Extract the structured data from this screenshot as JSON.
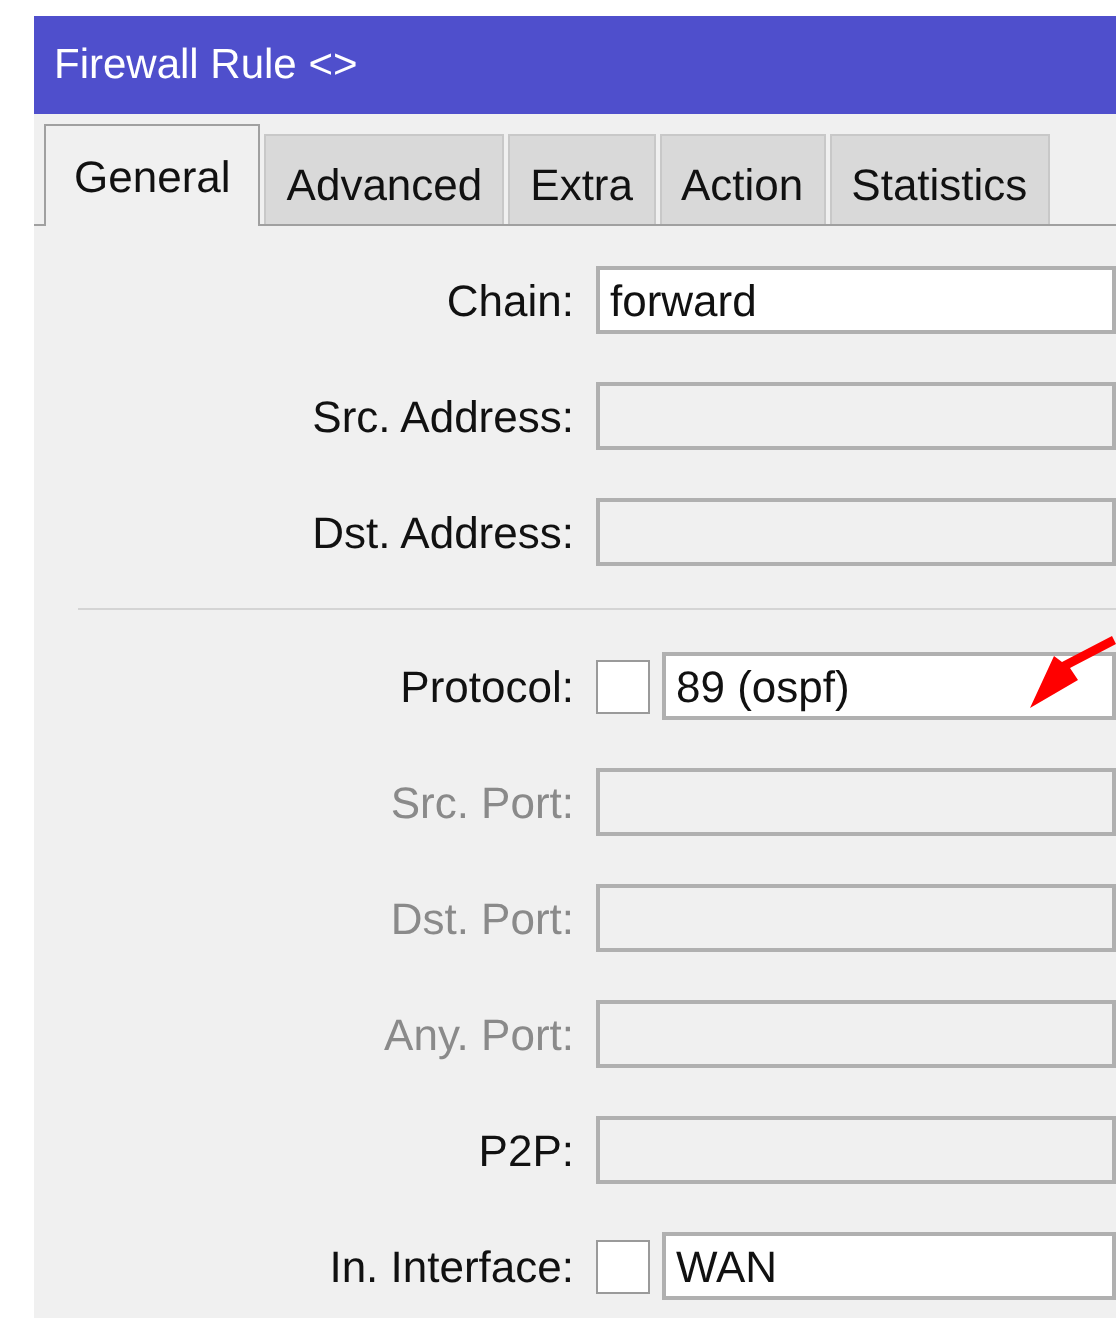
{
  "window": {
    "title": "Firewall Rule <>"
  },
  "tabs": [
    {
      "label": "General",
      "selected": true
    },
    {
      "label": "Advanced",
      "selected": false
    },
    {
      "label": "Extra",
      "selected": false
    },
    {
      "label": "Action",
      "selected": false
    },
    {
      "label": "Statistics",
      "selected": false
    }
  ],
  "sections": [
    {
      "fields": [
        {
          "kind": "plain",
          "label": "Chain:",
          "value": "forward",
          "set": true,
          "disabled": false
        },
        {
          "kind": "plain",
          "label": "Src. Address:",
          "set": false,
          "disabled": false
        },
        {
          "kind": "plain",
          "label": "Dst. Address:",
          "set": false,
          "disabled": false
        }
      ]
    },
    {
      "fields": [
        {
          "kind": "negatable",
          "label": "Protocol:",
          "value": "89 (ospf)",
          "set": true,
          "disabled": false,
          "checked": false
        },
        {
          "kind": "plain",
          "label": "Src. Port:",
          "set": false,
          "disabled": true
        },
        {
          "kind": "plain",
          "label": "Dst. Port:",
          "set": false,
          "disabled": true
        },
        {
          "kind": "plain",
          "label": "Any. Port:",
          "set": false,
          "disabled": true
        },
        {
          "kind": "plain",
          "label": "P2P:",
          "set": false,
          "disabled": false
        },
        {
          "kind": "negatable",
          "label": "In. Interface:",
          "value": "WAN",
          "set": true,
          "disabled": false,
          "checked": false
        }
      ]
    }
  ]
}
